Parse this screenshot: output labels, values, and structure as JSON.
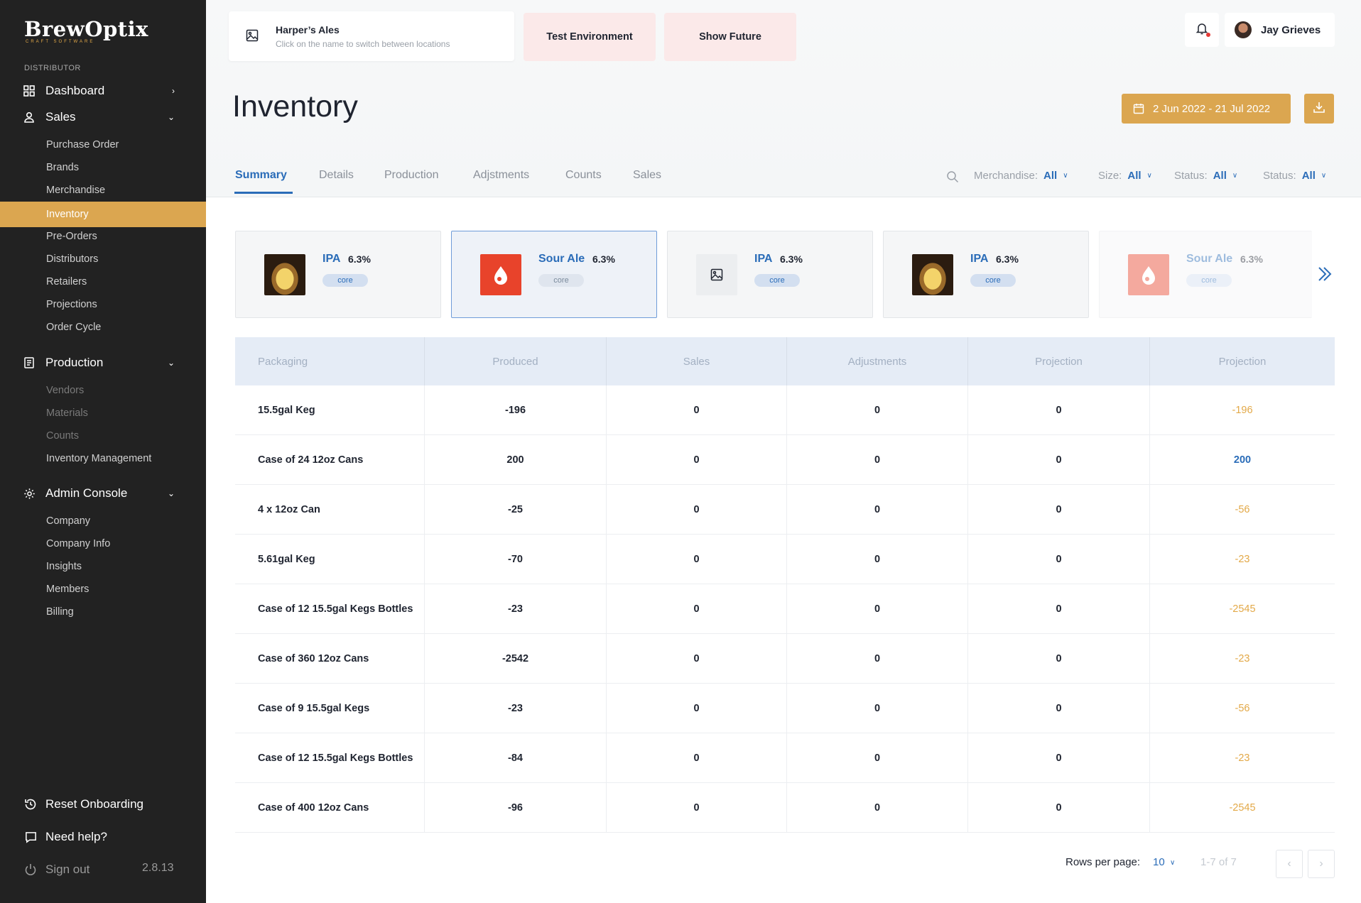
{
  "sidebar": {
    "logo": "BrewOptix",
    "logo_sub": "CRAFT SOFTWARE",
    "section": "DISTRIBUTOR",
    "dashboard": "Dashboard",
    "sales": "Sales",
    "sales_items": [
      "Purchase Order",
      "Brands",
      "Merchandise",
      "Inventory",
      "Pre-Orders",
      "Distributors",
      "Retailers",
      "Projections",
      "Order Cycle"
    ],
    "production": "Production",
    "production_items": [
      "Vendors",
      "Materials",
      "Counts",
      "Inventory Management"
    ],
    "admin": "Admin Console",
    "admin_items": [
      "Company",
      "Company Info",
      "Insights",
      "Members",
      "Billing"
    ],
    "reset": "Reset Onboarding",
    "help": "Need help?",
    "signout": "Sign out",
    "version": "2.8.13"
  },
  "header": {
    "location_name": "Harper’s Ales",
    "location_hint": "Click on the name to switch between locations",
    "test_env": "Test Environment",
    "show_future": "Show Future",
    "user_name": "Jay Grieves"
  },
  "page": {
    "title": "Inventory",
    "date_range": "2 Jun 2022 -  21 Jul 2022"
  },
  "tabs": [
    "Summary",
    "Details",
    "Production",
    "Adjstments",
    "Counts",
    "Sales"
  ],
  "filters": [
    {
      "label": "Merchandise:",
      "value": "All"
    },
    {
      "label": "Size:",
      "value": "All"
    },
    {
      "label": "Status:",
      "value": "All"
    },
    {
      "label": "Status:",
      "value": "All"
    }
  ],
  "products": [
    {
      "name": "IPA",
      "abv": "6.3%",
      "tag": "core",
      "image": "beer-glass"
    },
    {
      "name": "Sour Ale",
      "abv": "6.3%",
      "tag": "core",
      "image": "sour-cherry-can"
    },
    {
      "name": "IPA",
      "abv": "6.3%",
      "tag": "core",
      "image": "placeholder-icon"
    },
    {
      "name": "IPA",
      "abv": "6.3%",
      "tag": "core",
      "image": "beer-glass"
    },
    {
      "name": "Sour Ale",
      "abv": "6.3%",
      "tag": "core",
      "image": "sour-cherry-can"
    }
  ],
  "table": {
    "headers": [
      "Packaging",
      "Produced",
      "Sales",
      "Adjustments",
      "Projection",
      "Projection"
    ],
    "rows": [
      [
        "15.5gal Keg",
        "-196",
        "0",
        "0",
        "0",
        "-196"
      ],
      [
        "Case of 24 12oz Cans",
        "200",
        "0",
        "0",
        "0",
        "200"
      ],
      [
        "4 x 12oz Can",
        "-25",
        "0",
        "0",
        "0",
        "-56"
      ],
      [
        "5.61gal Keg",
        "-70",
        "0",
        "0",
        "0",
        "-23"
      ],
      [
        "Case of 12 15.5gal Kegs Bottles",
        "-23",
        "0",
        "0",
        "0",
        "-2545"
      ],
      [
        "Case of 360 12oz Cans",
        "-2542",
        "0",
        "0",
        "0",
        "-23"
      ],
      [
        "Case of 9 15.5gal Kegs",
        "-23",
        "0",
        "0",
        "0",
        "-56"
      ],
      [
        "Case of 12 15.5gal Kegs Bottles",
        "-84",
        "0",
        "0",
        "0",
        "-23"
      ],
      [
        "Case of 400 12oz Cans",
        "-96",
        "0",
        "0",
        "0",
        "-2545"
      ]
    ]
  },
  "pagination": {
    "rows_label": "Rows per page:",
    "rows_value": "10",
    "range": "1-7 of 7"
  },
  "colors": {
    "accent": "#dba650",
    "link": "#2a6cb8",
    "sidebar": "#222222",
    "negative": "#e3a948"
  }
}
